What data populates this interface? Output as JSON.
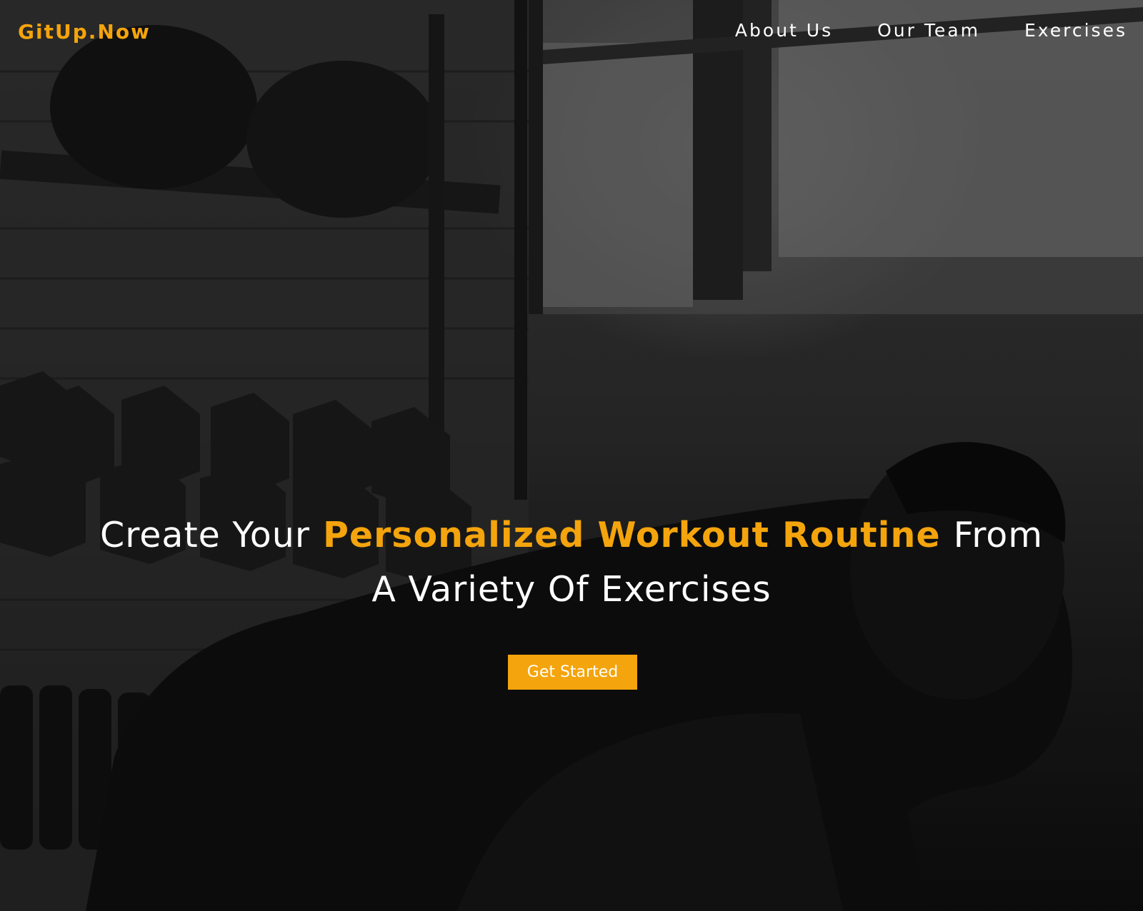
{
  "brand": {
    "logo_text": "GitUp.Now",
    "accent_color": "#f4a40c"
  },
  "nav": {
    "items": [
      {
        "label": "About Us"
      },
      {
        "label": "Our Team"
      },
      {
        "label": "Exercises"
      }
    ]
  },
  "hero": {
    "headline_before": "Create Your",
    "headline_highlight": "Personalized Workout Routine",
    "headline_after": "From",
    "headline_line2": "A Variety Of Exercises",
    "cta_label": "Get Started",
    "background_image": "gym-athlete-photo"
  }
}
